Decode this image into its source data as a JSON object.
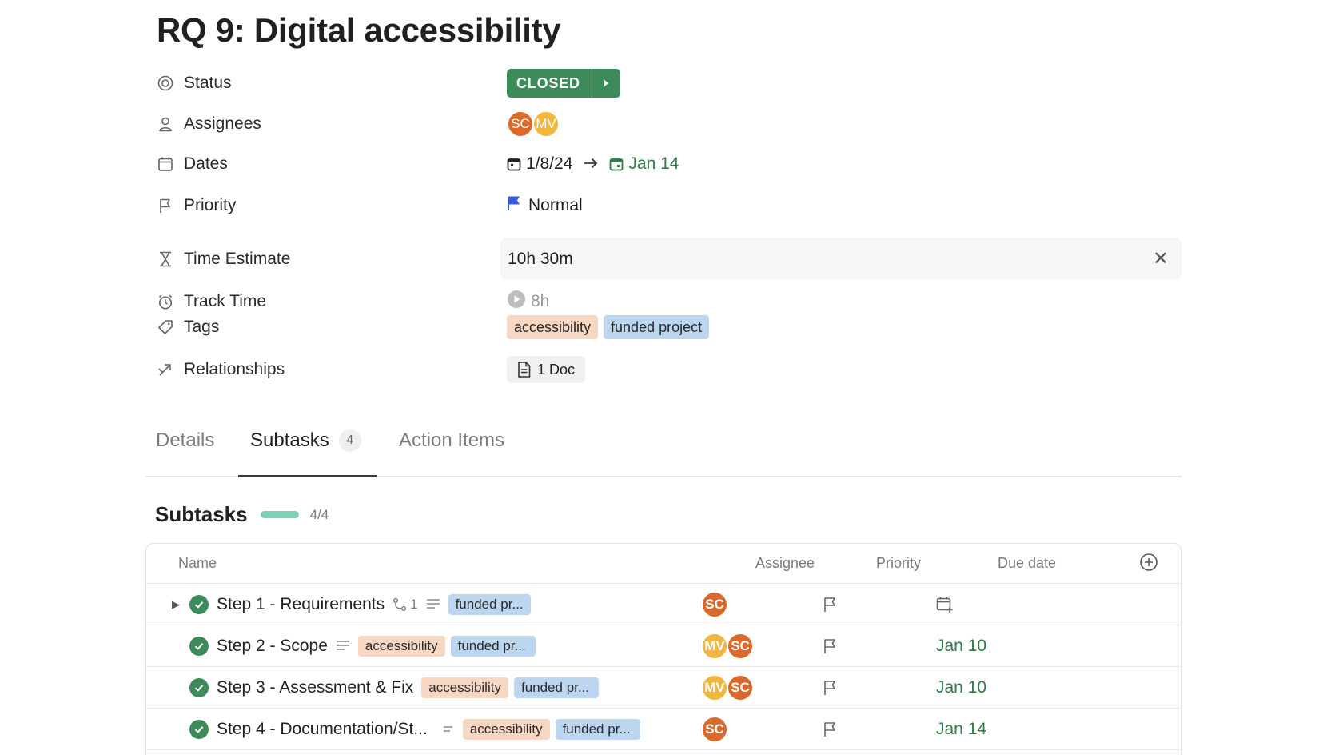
{
  "task": {
    "title": "RQ 9: Digital accessibility"
  },
  "properties": {
    "status": {
      "label": "Status",
      "value": "CLOSED",
      "color": "#3d8b5a"
    },
    "assignees": {
      "label": "Assignees",
      "people": [
        "SC",
        "MV"
      ]
    },
    "dates": {
      "label": "Dates",
      "start": "1/8/24",
      "end": "Jan 14"
    },
    "priority": {
      "label": "Priority",
      "value": "Normal",
      "flag_color": "#3b5bdb"
    },
    "time_estimate": {
      "label": "Time Estimate",
      "value": "10h 30m"
    },
    "track_time": {
      "label": "Track Time",
      "value": "8h"
    },
    "tags": {
      "label": "Tags",
      "items": [
        "accessibility",
        "funded project"
      ]
    },
    "relationships": {
      "label": "Relationships",
      "doc": "1 Doc"
    }
  },
  "tabs": [
    {
      "label": "Details"
    },
    {
      "label": "Subtasks",
      "count": "4"
    },
    {
      "label": "Action Items"
    }
  ],
  "subtasks": {
    "heading": "Subtasks",
    "progress": "4/4",
    "progress_fraction": 1.0,
    "columns": {
      "name": "Name",
      "assignee": "Assignee",
      "priority": "Priority",
      "due": "Due date"
    },
    "rows": [
      {
        "name": "Step 1 - Requirements",
        "sub_count": "1",
        "tags": [
          "funded pr..."
        ],
        "assignees": [
          "SC"
        ],
        "due": ""
      },
      {
        "name": "Step 2 - Scope",
        "tags": [
          "accessibility",
          "funded pr..."
        ],
        "assignees": [
          "MV",
          "SC"
        ],
        "due": "Jan 10"
      },
      {
        "name": "Step 3 - Assessment & Fix",
        "tags": [
          "accessibility",
          "funded pr..."
        ],
        "assignees": [
          "MV",
          "SC"
        ],
        "due": "Jan 10"
      },
      {
        "name": "Step 4 - Documentation/St...",
        "tags": [
          "accessibility",
          "funded pr..."
        ],
        "assignees": [
          "SC"
        ],
        "due": "Jan 14"
      }
    ]
  }
}
